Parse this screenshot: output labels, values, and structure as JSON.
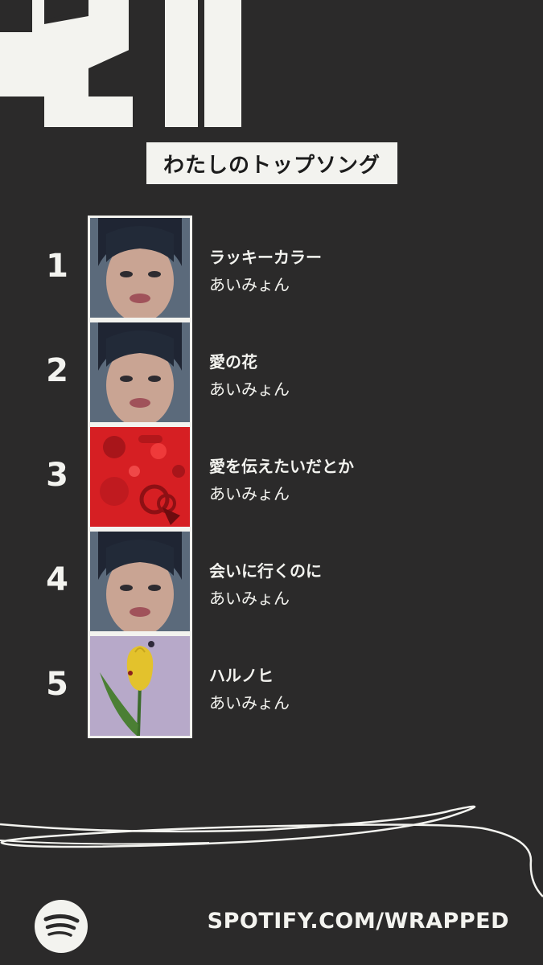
{
  "title": "わたしのトップソング",
  "tracks": [
    {
      "rank": "1",
      "song": "ラッキーカラー",
      "artist": "あいみょん",
      "cover": "portrait-cover"
    },
    {
      "rank": "2",
      "song": "愛の花",
      "artist": "あいみょん",
      "cover": "portrait-cover"
    },
    {
      "rank": "3",
      "song": "愛を伝えたいだとか",
      "artist": "あいみょん",
      "cover": "red-objects-cover"
    },
    {
      "rank": "4",
      "song": "会いに行くのに",
      "artist": "あいみょん",
      "cover": "portrait-cover"
    },
    {
      "rank": "5",
      "song": "ハルノヒ",
      "artist": "あいみょん",
      "cover": "tulip-cover"
    }
  ],
  "footer": {
    "url": "SPOTIFY.COM/WRAPPED",
    "logo": "spotify-logo-icon"
  },
  "colors": {
    "background": "#2b2a2a",
    "foreground": "#f3f3ef"
  }
}
